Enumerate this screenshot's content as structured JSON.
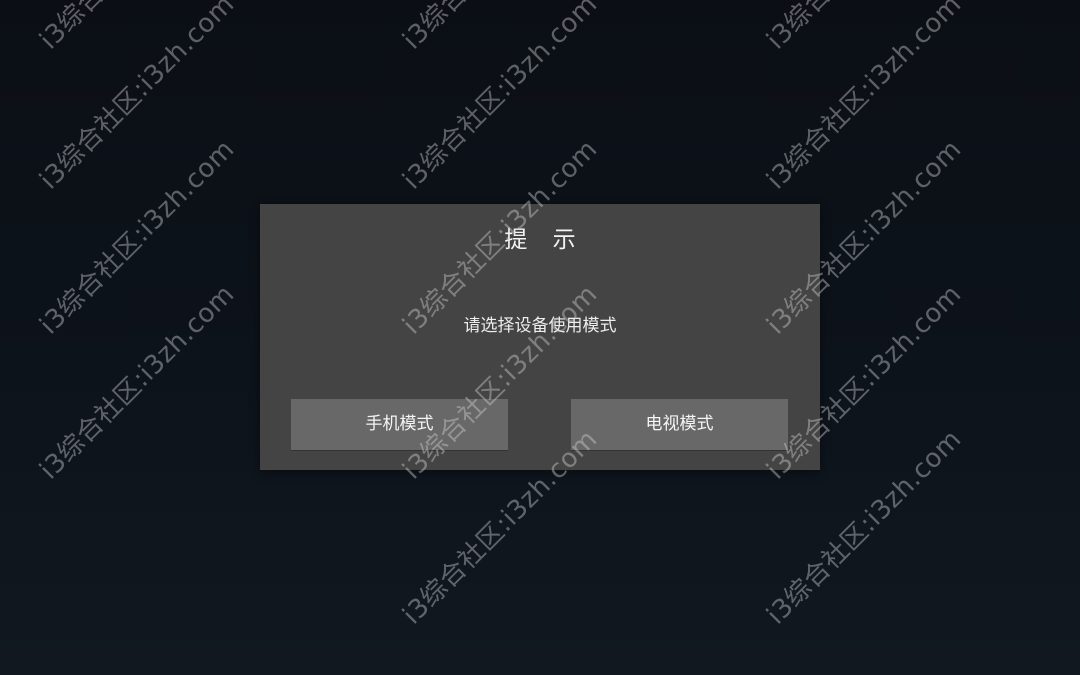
{
  "dialog": {
    "title": "提 示",
    "message": "请选择设备使用模式",
    "phone_button_label": "手机模式",
    "tv_button_label": "电视模式"
  },
  "watermark": {
    "text": "i3综合社区:i3zh.com"
  },
  "colors": {
    "background": "#0d131b",
    "dialog_bg": "#444444",
    "button_bg": "#686868",
    "text": "#f3f3f3"
  }
}
